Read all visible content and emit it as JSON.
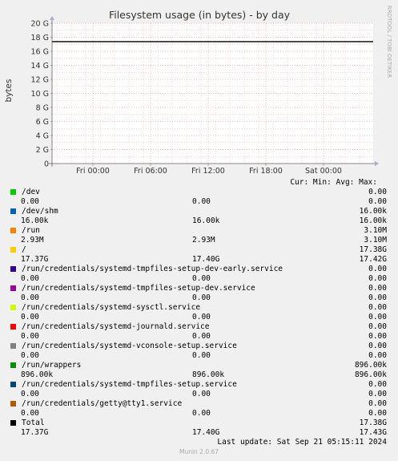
{
  "chart_data": {
    "type": "line",
    "title": "Filesystem usage (in bytes) - by day",
    "ylabel": "bytes",
    "side_label": "RRDTOOL / TOBI OETIKER",
    "ylim": [
      0,
      20
    ],
    "y_unit": "G",
    "y_ticks": [
      "0",
      "2 G",
      "4 G",
      "6 G",
      "8 G",
      "10 G",
      "12 G",
      "14 G",
      "16 G",
      "18 G",
      "20 G"
    ],
    "x_ticks": [
      "Fri 00:00",
      "Fri 06:00",
      "Fri 12:00",
      "Fri 18:00",
      "Sat 00:00"
    ],
    "grid": true,
    "series_line": {
      "name": "Total",
      "value": 17.38,
      "color": "#000000"
    },
    "legend_header": "Cur: Min: Avg: Max:",
    "legend": [
      {
        "name": "/dev",
        "color": "#00cc00",
        "cur": "0.00",
        "min": "0.00",
        "avg": "",
        "max": "0.00"
      },
      {
        "name": "/dev/shm",
        "color": "#0066b3",
        "cur": "16.00k",
        "min": "16.00k",
        "avg": "",
        "max": "16.00k"
      },
      {
        "name": "/run",
        "color": "#ff8000",
        "cur": "2.93M",
        "min": "2.93M",
        "avg": "",
        "max": "3.10M"
      },
      {
        "name": "/",
        "color": "#ffcc00",
        "cur": "17.37G",
        "min": "17.40G",
        "avg": "",
        "max": "17.42G",
        "extra": "17.38G"
      },
      {
        "name": "/run/credentials/systemd-tmpfiles-setup-dev-early.service",
        "color": "#330099",
        "cur": "0.00",
        "min": "0.00",
        "avg": "",
        "max": "0.00"
      },
      {
        "name": "/run/credentials/systemd-tmpfiles-setup-dev.service",
        "color": "#990099",
        "cur": "0.00",
        "min": "0.00",
        "avg": "",
        "max": "0.00"
      },
      {
        "name": "/run/credentials/systemd-sysctl.service",
        "color": "#ccff00",
        "cur": "0.00",
        "min": "0.00",
        "avg": "",
        "max": "0.00"
      },
      {
        "name": "/run/credentials/systemd-journald.service",
        "color": "#ff0000",
        "cur": "0.00",
        "min": "0.00",
        "avg": "",
        "max": "0.00"
      },
      {
        "name": "/run/credentials/systemd-vconsole-setup.service",
        "color": "#808080",
        "cur": "0.00",
        "min": "0.00",
        "avg": "",
        "max": "0.00"
      },
      {
        "name": "/run/wrappers",
        "color": "#008f00",
        "cur": "896.00k",
        "min": "896.00k",
        "avg": "",
        "max": "896.00k"
      },
      {
        "name": "/run/credentials/systemd-tmpfiles-setup.service",
        "color": "#00487d",
        "cur": "0.00",
        "min": "0.00",
        "avg": "",
        "max": "0.00"
      },
      {
        "name": "/run/credentials/getty@tty1.service",
        "color": "#b35a00",
        "cur": "0.00",
        "min": "0.00",
        "avg": "",
        "max": "0.00"
      },
      {
        "name": "Total",
        "color": "#000000",
        "cur": "17.37G",
        "min": "17.40G",
        "avg": "",
        "max": "17.43G",
        "extra": "17.38G"
      }
    ],
    "last_update": "Last update: Sat Sep 21 05:15:11 2024",
    "footer": "Munin 2.0.67"
  }
}
